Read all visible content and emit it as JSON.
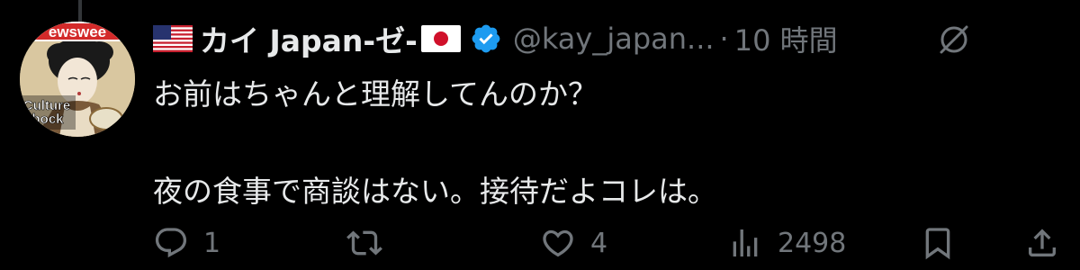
{
  "tweet": {
    "display_name": "カイ Japan-ゼ-",
    "handle": "@kay_japan...",
    "separator": "·",
    "time": "10 時間",
    "lines": [
      "お前はちゃんと理解してんのか？",
      "",
      "夜の食事で商談はない。接待だよコレは。"
    ]
  },
  "avatar": {
    "masthead_text": "ewswee",
    "badge_line1": "Culture",
    "badge_line2": "Shock"
  },
  "actions": {
    "reply_count": "1",
    "retweet_count": "",
    "like_count": "4",
    "views_count": "2498"
  },
  "icons": {
    "verified": "verified-badge-icon",
    "grok": "grok-icon",
    "reply": "reply-icon",
    "retweet": "retweet-icon",
    "like": "heart-icon",
    "views": "views-icon",
    "bookmark": "bookmark-icon",
    "share": "share-icon"
  },
  "colors": {
    "background": "#000000",
    "text_primary": "#e7e9ea",
    "text_secondary": "#71767b",
    "verified_blue": "#1d9bf0"
  }
}
